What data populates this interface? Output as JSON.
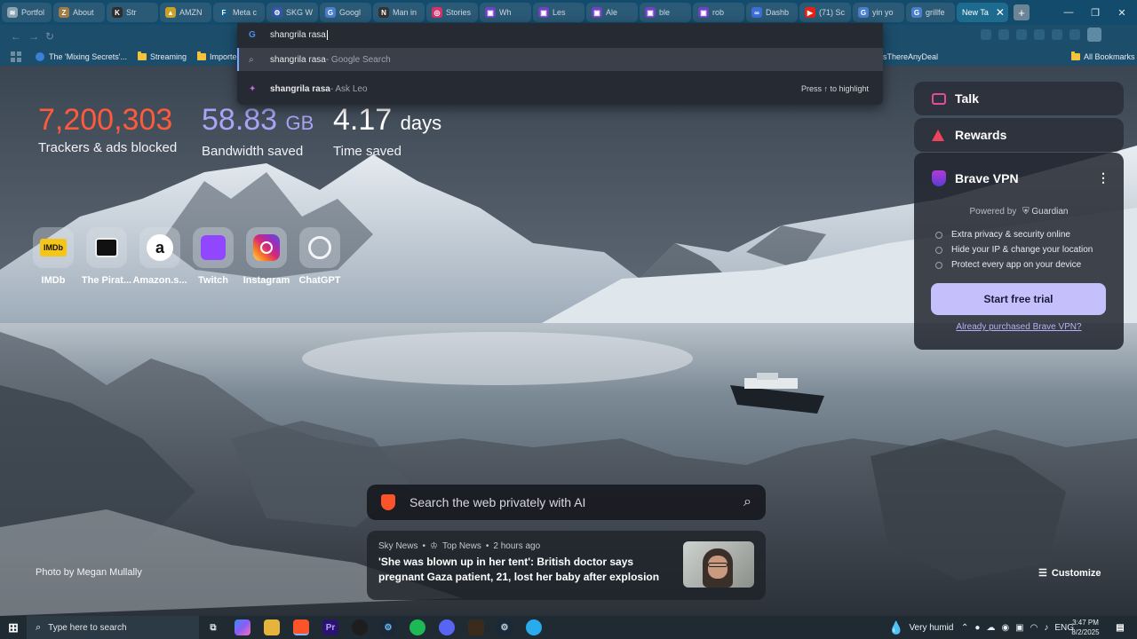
{
  "tabs": [
    {
      "label": "Portfol",
      "color": "#8aa3b5",
      "glyph": "≋"
    },
    {
      "label": "About",
      "color": "#a07c4a",
      "glyph": "Z"
    },
    {
      "label": "Str",
      "color": "#2e2e2e",
      "glyph": "K"
    },
    {
      "label": "AMZN",
      "color": "#c9a227",
      "glyph": "▲"
    },
    {
      "label": "Meta c",
      "color": "#1f5f86",
      "glyph": "F"
    },
    {
      "label": "SKG W",
      "color": "#3257a8",
      "glyph": "⚙"
    },
    {
      "label": "Googl",
      "color": "#4a7fd0",
      "glyph": "G"
    },
    {
      "label": "Man in",
      "color": "#333",
      "glyph": "N"
    },
    {
      "label": "Stories",
      "color": "#d6336c",
      "glyph": "◎"
    },
    {
      "label": "Wh",
      "color": "#6f42c1",
      "glyph": "▣"
    },
    {
      "label": "Les",
      "color": "#6f42c1",
      "glyph": "▣"
    },
    {
      "label": "Ale",
      "color": "#6f42c1",
      "glyph": "▣"
    },
    {
      "label": "ble",
      "color": "#6f42c1",
      "glyph": "▣"
    },
    {
      "label": "rob",
      "color": "#6f42c1",
      "glyph": "▣"
    },
    {
      "label": "Dashb",
      "color": "#3a6fd8",
      "glyph": "∞"
    },
    {
      "label": "(71) Sc",
      "color": "#e62117",
      "glyph": "▶"
    },
    {
      "label": "yin yo",
      "color": "#4a7fd0",
      "glyph": "G"
    },
    {
      "label": "grillfe",
      "color": "#4a7fd0",
      "glyph": "G"
    }
  ],
  "active_tab": {
    "label": "New Ta",
    "close": "✕"
  },
  "new_tab_label": "+",
  "window_controls": {
    "minimize": "—",
    "restore": "❐",
    "close": "✕"
  },
  "bookmarks": {
    "items": [
      {
        "label": "The 'Mixing Secrets'...",
        "type": "page"
      },
      {
        "label": "Streaming",
        "type": "folder"
      },
      {
        "label": "Imported fro",
        "type": "folder"
      }
    ],
    "right_item": "sThereAnyDeal",
    "all_label": "All Bookmarks"
  },
  "omnibox": {
    "query": "shangrila rasa",
    "rows": [
      {
        "text": "shangrila rasa",
        "suffix": " - Google Search"
      },
      {
        "text": "shangrila rasa",
        "suffix": " - Ask Leo",
        "hint": "Press ↑ to highlight"
      }
    ]
  },
  "stats": {
    "trackers_value": "7,200,303",
    "trackers_label": "Trackers & ads blocked",
    "bandwidth_value": "58.83",
    "bandwidth_unit": "GB",
    "bandwidth_label": "Bandwidth saved",
    "time_value": "4.17",
    "time_unit": "days",
    "time_label": "Time saved"
  },
  "top_sites": [
    {
      "name": "IMDb",
      "icon": "imdb-icon"
    },
    {
      "name": "The Pirat...",
      "icon": "pirate-icon"
    },
    {
      "name": "Amazon.s...",
      "icon": "amazon-icon"
    },
    {
      "name": "Twitch",
      "icon": "twitch-icon"
    },
    {
      "name": "Instagram",
      "icon": "instagram-icon"
    },
    {
      "name": "ChatGPT",
      "icon": "chatgpt-icon"
    }
  ],
  "right_panel": {
    "talk": "Talk",
    "rewards": "Rewards",
    "vpn_title": "Brave VPN",
    "powered_by": "Powered by",
    "powered_brand": "Guardian",
    "features": [
      "Extra privacy & security online",
      "Hide your IP & change your location",
      "Protect every app on your device"
    ],
    "trial_button": "Start free trial",
    "already_link": "Already purchased Brave VPN?"
  },
  "photo_credit": "Photo by Megan Mullally",
  "search": {
    "placeholder": "Search the web privately with AI"
  },
  "news": {
    "source": "Sky News",
    "tag": "Top News",
    "time": "2 hours ago",
    "headline": "'She was blown up in her tent': British doctor says pregnant Gaza patient, 21, lost her baby after explosion"
  },
  "customize_label": "Customize",
  "taskbar": {
    "search_placeholder": "Type here to search",
    "weather": "Very humid",
    "lang": "ENG",
    "time": "3:47 PM",
    "date": "8/2/2025"
  },
  "colors": {
    "trackers": "#ff5a3c",
    "bandwidth": "#a9a4f5",
    "accent": "#c5c0fb"
  }
}
